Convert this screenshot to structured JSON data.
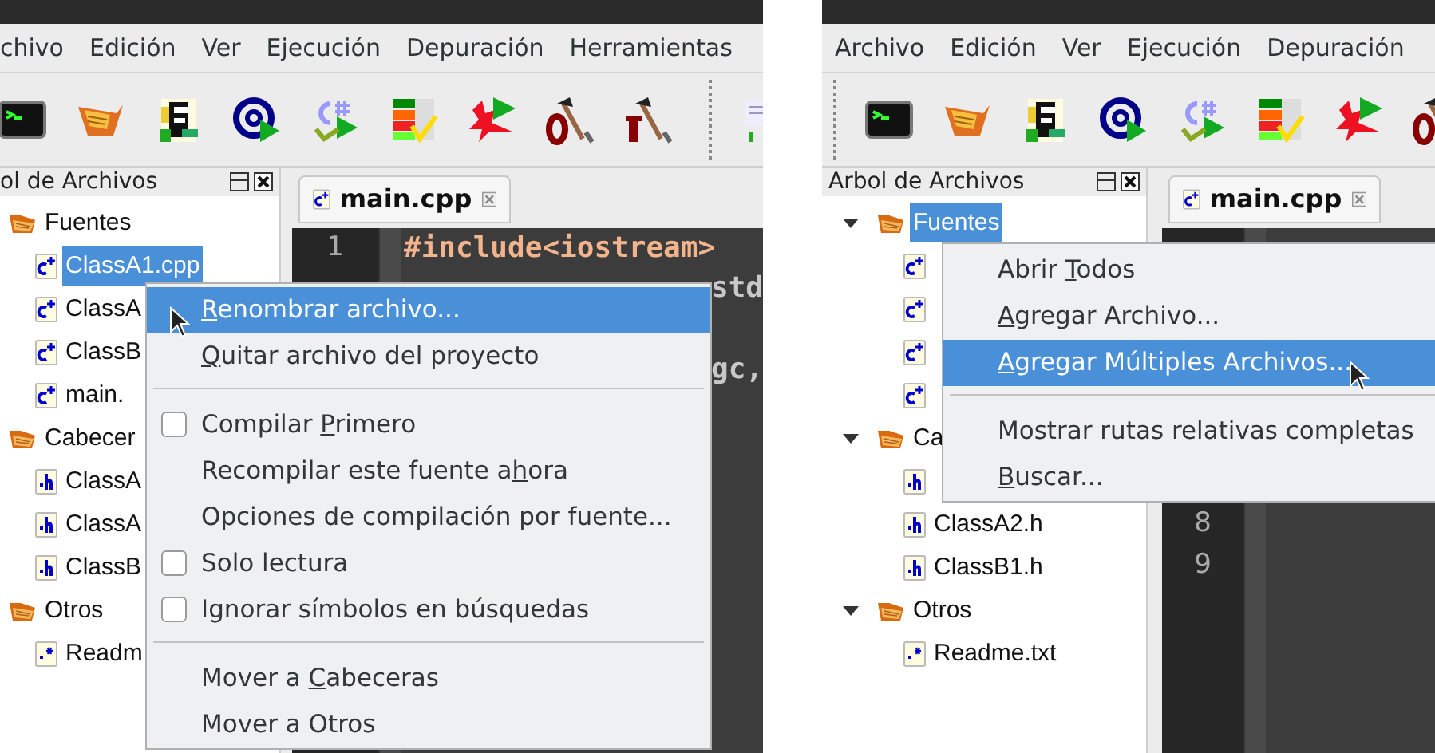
{
  "screens": [
    {
      "menubar": [
        "chivo",
        "Edición",
        "Ver",
        "Ejecución",
        "Depuración",
        "Herramientas"
      ],
      "toolbar": [
        {
          "kind": "terminal"
        },
        {
          "kind": "basket"
        },
        {
          "kind": "document"
        },
        {
          "kind": "at"
        },
        {
          "kind": "csharp"
        },
        {
          "kind": "checklist"
        },
        {
          "kind": "dragon"
        },
        {
          "kind": "hammer0"
        },
        {
          "kind": "hammer1"
        },
        {
          "kind": "grip"
        },
        {
          "kind": "notepad"
        }
      ],
      "tree_title": "ol de Archivos",
      "tree": [
        {
          "label": "Fuentes",
          "kind": "folder",
          "selected": false,
          "children": [
            {
              "label": "ClassA1.cpp",
              "kind": "cpp",
              "selected": true
            },
            {
              "label": "ClassA",
              "kind": "cpp",
              "selected": false
            },
            {
              "label": "ClassB",
              "kind": "cpp",
              "selected": false
            },
            {
              "label": "main.",
              "kind": "cpp",
              "selected": false
            }
          ]
        },
        {
          "label": "Cabecer",
          "kind": "folder",
          "selected": false,
          "children": [
            {
              "label": "ClassA",
              "kind": "h",
              "selected": false
            },
            {
              "label": "ClassA",
              "kind": "h",
              "selected": false
            },
            {
              "label": "ClassB",
              "kind": "h",
              "selected": false
            }
          ]
        },
        {
          "label": "Otros",
          "kind": "folder",
          "selected": false,
          "children": [
            {
              "label": "Readm",
              "kind": "txt",
              "selected": false
            }
          ]
        }
      ],
      "tab": "main.cpp",
      "editor_lines": [
        {
          "number": "1",
          "text": "#include<iostream>",
          "kind": "directive"
        },
        {
          "text": "std",
          "kind": "fragment"
        },
        {
          "kind": "blank"
        },
        {
          "text": "gc,",
          "kind": "fragment"
        }
      ],
      "context_menu": [
        {
          "kind": "item",
          "text": {
            "key": "R",
            "after": "enombrar archivo..."
          },
          "selected": true
        },
        {
          "kind": "item",
          "text": {
            "key": "Q",
            "after": "uitar archivo del proyecto"
          },
          "selected": false
        },
        {
          "kind": "separator"
        },
        {
          "kind": "check",
          "text": {
            "before": "Compilar ",
            "key": "P",
            "after": "rimero"
          },
          "checked": false,
          "selected": false
        },
        {
          "kind": "item",
          "text": {
            "before": "Recompilar este fuente a",
            "key": "h",
            "after": "ora"
          },
          "selected": false
        },
        {
          "kind": "item",
          "text": {
            "before": "Opciones de compilación por fuente..."
          },
          "selected": false
        },
        {
          "kind": "check",
          "text": {
            "before": "Solo lectura"
          },
          "checked": false,
          "selected": false
        },
        {
          "kind": "check",
          "text": {
            "before": "Ignorar símbolos en búsquedas"
          },
          "checked": false,
          "selected": false
        },
        {
          "kind": "separator"
        },
        {
          "kind": "item",
          "text": {
            "before": "Mover a ",
            "key": "C",
            "after": "abeceras"
          },
          "selected": false
        },
        {
          "kind": "item",
          "text": {
            "before": "Mover a Otros"
          },
          "selected": false
        }
      ]
    },
    {
      "menubar": [
        "Archivo",
        "Edición",
        "Ver",
        "Ejecución",
        "Depuración"
      ],
      "toolbar": [
        {
          "kind": "grip"
        },
        {
          "kind": "terminal"
        },
        {
          "kind": "basket"
        },
        {
          "kind": "document"
        },
        {
          "kind": "at"
        },
        {
          "kind": "csharp"
        },
        {
          "kind": "checklist"
        },
        {
          "kind": "dragon"
        },
        {
          "kind": "hammer0"
        }
      ],
      "tree_title": "Arbol de Archivos",
      "tree": [
        {
          "label": "Fuentes",
          "kind": "folder",
          "expanded": true,
          "selected": true,
          "children": [
            {
              "kind": "cpp",
              "selected": false
            },
            {
              "kind": "cpp",
              "selected": false
            },
            {
              "kind": "cpp",
              "selected": false
            },
            {
              "kind": "cpp",
              "selected": false
            }
          ]
        },
        {
          "label": "Ca",
          "kind": "folder",
          "expanded": true,
          "selected": false,
          "children": [
            {
              "kind": "h",
              "selected": false
            },
            {
              "label": "ClassA2.h",
              "kind": "h",
              "selected": false
            },
            {
              "label": "ClassB1.h",
              "kind": "h",
              "selected": false
            }
          ]
        },
        {
          "label": "Otros",
          "kind": "folder",
          "expanded": true,
          "selected": false,
          "children": [
            {
              "label": "Readme.txt",
              "kind": "txt",
              "selected": false
            }
          ]
        }
      ],
      "tab": "main.cpp",
      "editor_lines": [
        {
          "number": "8",
          "kind": "blank"
        },
        {
          "number": "9",
          "kind": "blank"
        }
      ],
      "context_menu": [
        {
          "kind": "item",
          "text": {
            "before": "Abrir ",
            "key": "T",
            "after": "odos"
          },
          "selected": false
        },
        {
          "kind": "item",
          "text": {
            "key": "A",
            "after": "gregar Archivo..."
          },
          "selected": false
        },
        {
          "kind": "item",
          "text": {
            "key": "A",
            "after": "gregar Múltiples Archivos..."
          },
          "selected": true
        },
        {
          "kind": "separator"
        },
        {
          "kind": "item",
          "text": {
            "before": "Mostrar rutas relativas completas"
          },
          "selected": false
        },
        {
          "kind": "item",
          "text": {
            "key": "B",
            "after": "uscar..."
          },
          "selected": false
        }
      ]
    }
  ]
}
